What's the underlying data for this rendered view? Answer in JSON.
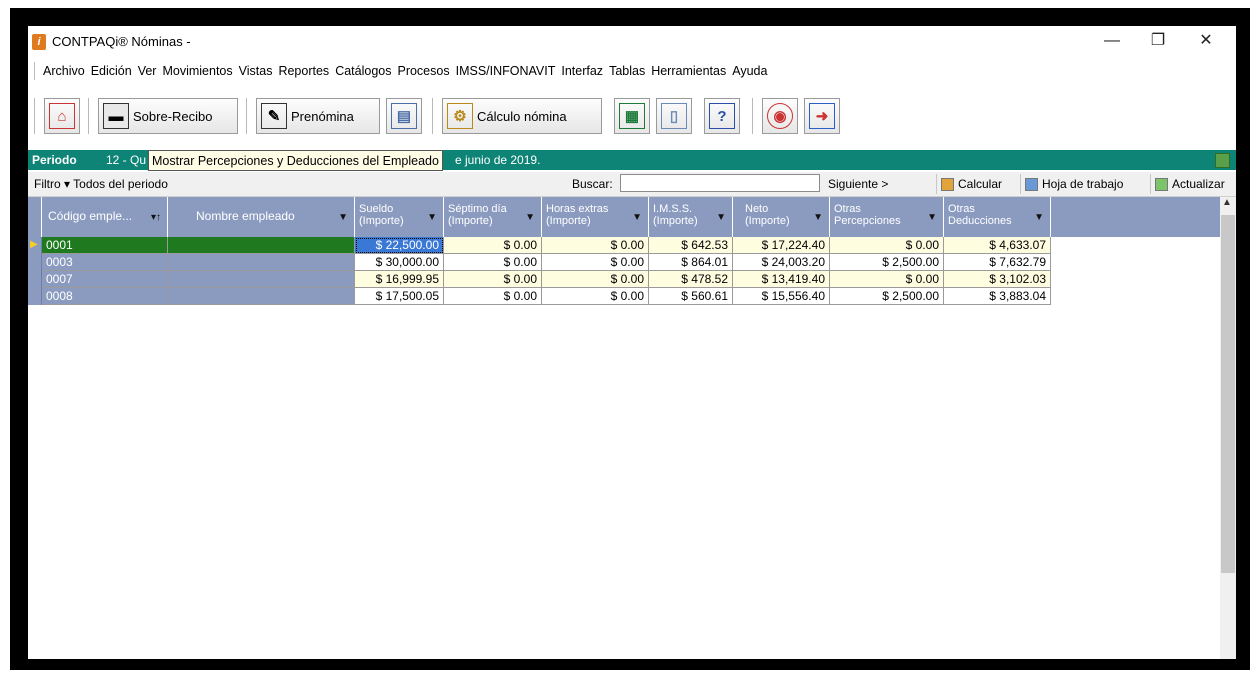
{
  "window": {
    "title": "CONTPAQi® Nóminas -",
    "controls": {
      "minimize": "—",
      "restore": "❐",
      "close": "✕"
    }
  },
  "menu": [
    "Archivo",
    "Edición",
    "Ver",
    "Movimientos",
    "Vistas",
    "Reportes",
    "Catálogos",
    "Procesos",
    "IMSS/INFONAVIT",
    "Interfaz",
    "Tablas",
    "Herramientas",
    "Ayuda"
  ],
  "toolbar": {
    "sobre_recibo": "Sobre-Recibo",
    "prenomina": "Prenómina",
    "calculo": "Cálculo nómina"
  },
  "period": {
    "label": "Periodo",
    "number": "12 - Qu",
    "date_suffix": "e junio de 2019.",
    "tooltip": "Mostrar Percepciones y Deducciones del Empleado"
  },
  "filter": {
    "filtro": "Filtro ▾  Todos del periodo",
    "buscar": "Buscar:",
    "buscar_value": "",
    "siguiente": "Siguiente >",
    "calcular": "Calcular",
    "hoja": "Hoja de trabajo",
    "actualizar": "Actualizar"
  },
  "colors": {
    "period_bar": "#0e8477",
    "header": "#8b9bc0",
    "selected_code": "#1f7a1f",
    "selected_sueldo": "#3a78d6",
    "cell_yellow": "#fffde0"
  },
  "table": {
    "columns": [
      {
        "l1": "Código emple...",
        "l2": ""
      },
      {
        "l1": "Nombre empleado",
        "l2": ""
      },
      {
        "l1": "Sueldo",
        "l2": "(Importe)"
      },
      {
        "l1": "Séptimo día",
        "l2": "(Importe)"
      },
      {
        "l1": "Horas extras",
        "l2": "(Importe)"
      },
      {
        "l1": "I.M.S.S.",
        "l2": "(Importe)"
      },
      {
        "l1": "Neto",
        "l2": "(Importe)"
      },
      {
        "l1": "Otras",
        "l2": "Percepciones"
      },
      {
        "l1": "Otras",
        "l2": "Deducciones"
      }
    ],
    "rows": [
      {
        "code": "0001",
        "name": "",
        "sueldo": "$ 22,500.00",
        "septimo": "$ 0.00",
        "horas": "$ 0.00",
        "imss": "$ 642.53",
        "neto": "$ 17,224.40",
        "op": "$ 0.00",
        "od": "$ 4,633.07"
      },
      {
        "code": "0003",
        "name": "",
        "sueldo": "$ 30,000.00",
        "septimo": "$ 0.00",
        "horas": "$ 0.00",
        "imss": "$ 864.01",
        "neto": "$ 24,003.20",
        "op": "$ 2,500.00",
        "od": "$ 7,632.79"
      },
      {
        "code": "0007",
        "name": "",
        "sueldo": "$ 16,999.95",
        "septimo": "$ 0.00",
        "horas": "$ 0.00",
        "imss": "$ 478.52",
        "neto": "$ 13,419.40",
        "op": "$ 0.00",
        "od": "$ 3,102.03"
      },
      {
        "code": "0008",
        "name": "",
        "sueldo": "$ 17,500.05",
        "septimo": "$ 0.00",
        "horas": "$ 0.00",
        "imss": "$ 560.61",
        "neto": "$ 15,556.40",
        "op": "$ 2,500.00",
        "od": "$ 3,883.04"
      }
    ]
  }
}
